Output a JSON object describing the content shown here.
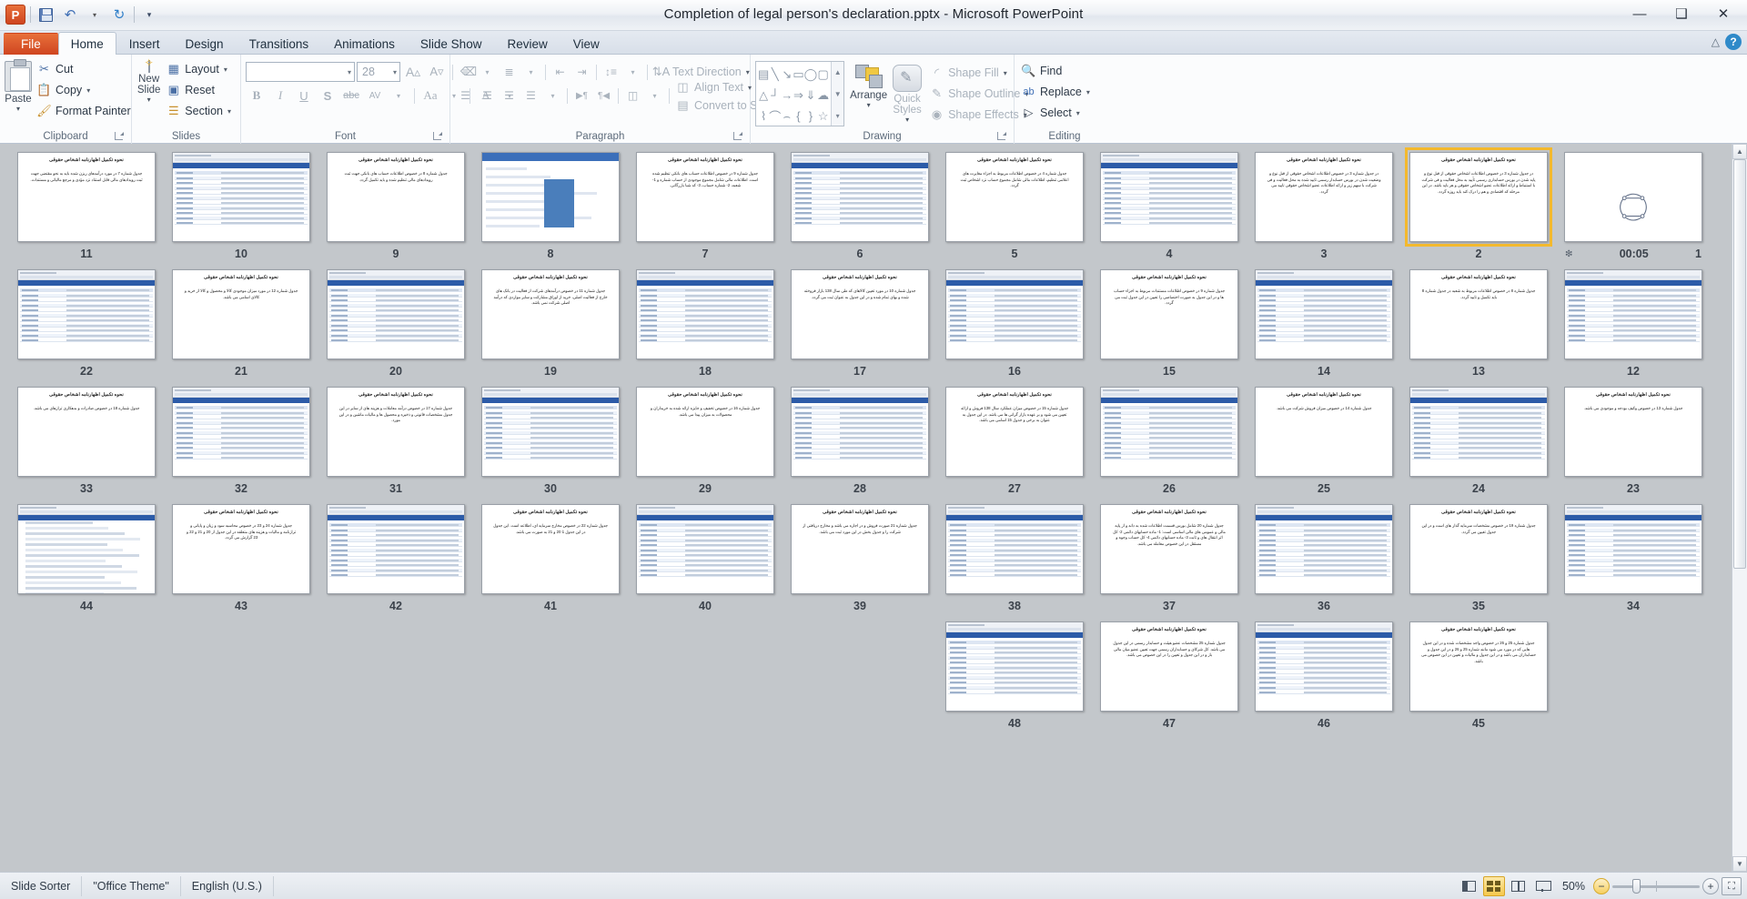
{
  "titlebar": {
    "document_title": "Completion of legal person's declaration.pptx  -  Microsoft PowerPoint",
    "app_icon": "powerpoint-icon",
    "qat": [
      {
        "name": "save-button",
        "icon": "save-icon",
        "label": ""
      },
      {
        "name": "undo-button",
        "icon": "undo-icon",
        "label": "↶"
      },
      {
        "name": "undo-dropdown",
        "icon": "chevron-down-icon",
        "label": "▾"
      },
      {
        "name": "redo-button",
        "icon": "redo-icon",
        "label": "↻"
      },
      {
        "name": "customize-qat",
        "icon": "chevron-down-icon",
        "label": "▾"
      }
    ],
    "window_controls": [
      {
        "name": "minimize-button",
        "glyph": "—"
      },
      {
        "name": "restore-button",
        "glyph": "❐"
      },
      {
        "name": "close-button",
        "glyph": "✕"
      }
    ]
  },
  "tabs": [
    {
      "label": "File",
      "name": "tab-file",
      "style": "file"
    },
    {
      "label": "Home",
      "name": "tab-home",
      "style": "active"
    },
    {
      "label": "Insert",
      "name": "tab-insert",
      "style": ""
    },
    {
      "label": "Design",
      "name": "tab-design",
      "style": ""
    },
    {
      "label": "Transitions",
      "name": "tab-transitions",
      "style": ""
    },
    {
      "label": "Animations",
      "name": "tab-animations",
      "style": ""
    },
    {
      "label": "Slide Show",
      "name": "tab-slide-show",
      "style": ""
    },
    {
      "label": "Review",
      "name": "tab-review",
      "style": ""
    },
    {
      "label": "View",
      "name": "tab-view",
      "style": ""
    }
  ],
  "tabstrip_right": {
    "minimize_ribbon": "△",
    "help": "?"
  },
  "ribbon": {
    "clipboard": {
      "label": "Clipboard",
      "paste": "Paste",
      "cut": "Cut",
      "copy": "Copy",
      "format_painter": "Format Painter"
    },
    "slides": {
      "label": "Slides",
      "new_slide": "New Slide",
      "layout": "Layout",
      "reset": "Reset",
      "section": "Section"
    },
    "font": {
      "label": "Font",
      "font_name_value": "",
      "font_name_placeholder": "",
      "font_size_value": "28",
      "buttons": [
        {
          "name": "grow-font-button",
          "glyph": "A▴"
        },
        {
          "name": "shrink-font-button",
          "glyph": "A▾"
        },
        {
          "name": "clear-formatting-button",
          "glyph": "✐"
        },
        {
          "name": "bold-button",
          "glyph": "B"
        },
        {
          "name": "italic-button",
          "glyph": "I"
        },
        {
          "name": "underline-button",
          "glyph": "U"
        },
        {
          "name": "shadow-button",
          "glyph": "S"
        },
        {
          "name": "strikethrough-button",
          "glyph": "abc"
        },
        {
          "name": "character-spacing-button",
          "glyph": "AV"
        },
        {
          "name": "change-case-button",
          "glyph": "Aa"
        },
        {
          "name": "font-color-button",
          "glyph": "A"
        }
      ]
    },
    "paragraph": {
      "label": "Paragraph",
      "text_direction": "Text Direction",
      "align_text": "Align Text",
      "convert_to_smartart": "Convert to SmartArt",
      "buttons": [
        {
          "name": "bullets-button",
          "glyph": "≡"
        },
        {
          "name": "numbering-button",
          "glyph": "≣"
        },
        {
          "name": "decrease-indent-button",
          "glyph": "⇤"
        },
        {
          "name": "increase-indent-button",
          "glyph": "⇥"
        },
        {
          "name": "line-spacing-button",
          "glyph": "↕"
        },
        {
          "name": "align-left-button",
          "glyph": "☰"
        },
        {
          "name": "align-center-button",
          "glyph": "☰"
        },
        {
          "name": "align-right-button",
          "glyph": "☰"
        },
        {
          "name": "justify-button",
          "glyph": "☰"
        },
        {
          "name": "ltr-button",
          "glyph": "▶¶"
        },
        {
          "name": "rtl-button",
          "glyph": "¶◀"
        },
        {
          "name": "columns-button",
          "glyph": "‖"
        }
      ]
    },
    "drawing": {
      "label": "Drawing",
      "arrange": "Arrange",
      "quick_styles": "Quick Styles",
      "shape_fill": "Shape Fill",
      "shape_outline": "Shape Outline",
      "shape_effects": "Shape Effects",
      "shapes": [
        "▤",
        "╲",
        "↘",
        "▭",
        "◯",
        "▢",
        "△",
        "┘",
        "→",
        "⇒",
        "⇓",
        "☁",
        "⌇",
        "⌒",
        "⌢",
        "{",
        "}",
        "☆"
      ]
    },
    "editing": {
      "label": "Editing",
      "find": "Find",
      "replace": "Replace",
      "select": "Select"
    }
  },
  "slide_sorter": {
    "selected_slide": 2,
    "transition_timer": {
      "slide": 1,
      "value": "00:05",
      "icon": "transition-star-icon"
    },
    "rows": [
      [
        {
          "num": "11",
          "kind": "text",
          "title": "نحوه تکمیل اظهارنامه اشخاص حقوقی",
          "body": "جدول شماره 7 در مورد درآمدهای ریزن شده باید به نحو مقتضی جهت ثبت رویدادهای مالی قابل استناد نزد مؤدی و مرجع مالیاتی و مستندات."
        },
        {
          "num": "10",
          "kind": "shot",
          "title": "",
          "body": ""
        },
        {
          "num": "9",
          "kind": "text",
          "title": "نحوه تکمیل اظهارنامه اشخاص حقوقی",
          "body": "جدول شماره 8 در خصوص اطلاعات حساب های بانکی جهت ثبت رویدادهای مالی تنظیم شده و باید تکمیل گردد."
        },
        {
          "num": "8",
          "kind": "form",
          "title": "",
          "body": ""
        },
        {
          "num": "7",
          "kind": "text",
          "title": "نحوه تکمیل اظهارنامه اشخاص حقوقی",
          "body": "جدول شماره 9 در خصوص اطلاعات حساب های بانکی تنظیم شده است. اطلاعات مالی شامل مجموع موجودی از حساب شماره و 1- شعبه، 2- شماره حساب، 3- کد شبا بازرگانی."
        },
        {
          "num": "6",
          "kind": "shot",
          "title": "",
          "body": ""
        },
        {
          "num": "5",
          "kind": "text",
          "title": "نحوه تکمیل اظهارنامه اشخاص حقوقی",
          "body": "جدول شماره 4 در خصوص اطلاعات مربوط به اجزاء مغایرت های اعلامی تنظیم، اطلاعات مالی شامل مجموع حساب نزد اشخاص ثبت گردد."
        },
        {
          "num": "4",
          "kind": "shot",
          "title": "",
          "body": ""
        },
        {
          "num": "3",
          "kind": "text",
          "title": "نحوه تکمیل اظهارنامه اشخاص حقوقی",
          "body": "در جدول شماره 3 در خصوص اطلاعات اشخاص حقوقی از قبل نوع و وضعیت شدن در بورس حسابدار رسمی تایید شده به محل فعالیت و فی شرکت با سهم زیر و ارائه اطلاعات عضو اشخاص حقوقی تایید می گردد."
        },
        {
          "num": "2",
          "kind": "text",
          "selected": true,
          "title": "نحوه تکمیل اظهارنامه اشخاص حقوقی",
          "body": "در جدول شماره 3 در خصوص اطلاعات اشخاص حقوقی از قبل نوع و پایه شدن در بورس حسابداری رسمی تأیید به محل فعالیت و فی شرکت با استنباط و ارائه اطلاعات عضو اشخاص حقوقی و هر باید باشد. در این مرحله که اقتصادی و هم را درک کند باید روزه گردد."
        },
        {
          "num": "1",
          "kind": "logo",
          "title": "",
          "body": "",
          "timer": "00:05"
        }
      ],
      [
        {
          "num": "22",
          "kind": "shot",
          "title": "",
          "body": ""
        },
        {
          "num": "21",
          "kind": "text",
          "title": "نحوه تکمیل اظهارنامه اشخاص حقوقی",
          "body": "جدول شماره 12 در مورد میزان موجودی کالا و محصول و کالا از خرید و کالای اسامی می باشد."
        },
        {
          "num": "20",
          "kind": "shot",
          "title": "",
          "body": ""
        },
        {
          "num": "19",
          "kind": "text",
          "title": "نحوه تکمیل اظهارنامه اشخاص حقوقی",
          "body": "جدول شماره 11 در خصوص درآمدهای شرکت از فعالیت در بانک های خارج از فعالیت اصلی، خرید از اوراق مشارکت و سایر مواردی که درآمد اصلی شرکت نمی باشد."
        },
        {
          "num": "18",
          "kind": "shot",
          "title": "",
          "body": ""
        },
        {
          "num": "17",
          "kind": "text",
          "title": "نحوه تکمیل اظهارنامه اشخاص حقوقی",
          "body": "جدول شماره 10 در مورد تعیین کالاهای که طی سال 138 بازار فروخته شده و بهای تمام شده و در این جدول به عنوان ثبت می گردد."
        },
        {
          "num": "16",
          "kind": "shot",
          "title": "",
          "body": ""
        },
        {
          "num": "15",
          "kind": "text",
          "title": "نحوه تکمیل اظهارنامه اشخاص حقوقی",
          "body": "جدول شماره 9 در خصوص اطلاعات مستندات مربوط به اجزاء حساب ها و در این جدول به صورت اختصاصی را تعیین در این جدول ثبت می گردد."
        },
        {
          "num": "14",
          "kind": "shot",
          "title": "",
          "body": ""
        },
        {
          "num": "13",
          "kind": "text",
          "title": "نحوه تکمیل اظهارنامه اشخاص حقوقی",
          "body": "جدول شماره 8 در خصوص اطلاعات مربوط به شعبه در جدول شماره 8 باید تکمیل و تایید گردد."
        },
        {
          "num": "12",
          "kind": "shot",
          "title": "",
          "body": ""
        }
      ],
      [
        {
          "num": "33",
          "kind": "text",
          "title": "نحوه تکمیل اظهارنامه اشخاص حقوقی",
          "body": "جدول شماره 18 در خصوص صادرات و بدهکاری ترازهای می باشد."
        },
        {
          "num": "32",
          "kind": "shot",
          "title": "",
          "body": ""
        },
        {
          "num": "31",
          "kind": "text",
          "title": "نحوه تکمیل اظهارنامه اشخاص حقوقی",
          "body": "جدول شماره 17 در خصوص درآمد معاملات و هزینه های از سایر در این جدول مشخصات قانونی و ذخیره و محصول ها و مالیات ماشین و در این مورد."
        },
        {
          "num": "30",
          "kind": "shot",
          "title": "",
          "body": ""
        },
        {
          "num": "29",
          "kind": "text",
          "title": "نحوه تکمیل اظهارنامه اشخاص حقوقی",
          "body": "جدول شماره 16 در خصوص تخفیف و جایزه ارائه شده به خریداران و محصولات به میزان پیدا می باشد."
        },
        {
          "num": "28",
          "kind": "shot",
          "title": "",
          "body": ""
        },
        {
          "num": "27",
          "kind": "text",
          "title": "نحوه تکمیل اظهارنامه اشخاص حقوقی",
          "body": "جدول شماره 15 در خصوص میزان عملکرد سال 138 فروش و ارائه تعیین می شود و بر عهده بازار گرانی ها می باشد. در این جدول به عنوان به برخی و جدول 15 اسامی می باشد."
        },
        {
          "num": "26",
          "kind": "shot",
          "title": "",
          "body": ""
        },
        {
          "num": "25",
          "kind": "text",
          "title": "نحوه تکمیل اظهارنامه اشخاص حقوقی",
          "body": "جدول شماره 14 در خصوص میزان فروش شرکت می باشد."
        },
        {
          "num": "24",
          "kind": "shot",
          "title": "",
          "body": ""
        },
        {
          "num": "23",
          "kind": "text",
          "title": "نحوه تکمیل اظهارنامه اشخاص حقوقی",
          "body": "جدول شماره 13 در خصوص وکیف بودجه و موجودی می باشد."
        }
      ],
      [
        {
          "num": "44",
          "kind": "bullets",
          "title": "",
          "body": ""
        },
        {
          "num": "43",
          "kind": "text",
          "title": "نحوه تکمیل اظهارنامه اشخاص حقوقی",
          "body": "جدول شماره 24 و 23 در خصوص محاسبه سود و زیان و پایانی و ترازنامه و مالیات و هزینه های متعلقه در این جدول از 20 و 21 و 22 و 23 گزارش می گردد."
        },
        {
          "num": "42",
          "kind": "shot",
          "title": "",
          "body": ""
        },
        {
          "num": "41",
          "kind": "text",
          "title": "نحوه تکمیل اظهارنامه اشخاص حقوقی",
          "body": "جدول شماره 22 در خصوص مخارج سرمایه ای، اطلاعه است. این جدول در این جدول تا 20 و 21 به صورت می باشد."
        },
        {
          "num": "40",
          "kind": "shot",
          "title": "",
          "body": ""
        },
        {
          "num": "39",
          "kind": "text",
          "title": "نحوه تکمیل اظهارنامه اشخاص حقوقی",
          "body": "جدول شماره 21 صورت فروش و در اجاره می باشد و مخارج دریافتی از شرکت را و جدول بخش در این مورد ثبت می باشد."
        },
        {
          "num": "38",
          "kind": "shot",
          "title": "",
          "body": ""
        },
        {
          "num": "37",
          "kind": "text",
          "title": "نحوه تکمیل اظهارنامه اشخاص حقوقی",
          "body": "جدول شماره 20 شامل بورس قسمت اطلاعات شده به دانه و از پایه مالی و عمومی های مالی اساسی است: 1- ماده حسابهای دائمی 2- کل اثر انتقال های و ثابت 3- ماده حسابهای دائمی 4- کل حساب وجوه و مستقل در این خصوص معامله می باشد."
        },
        {
          "num": "36",
          "kind": "shot",
          "title": "",
          "body": ""
        },
        {
          "num": "35",
          "kind": "text",
          "title": "نحوه تکمیل اظهارنامه اشخاص حقوقی",
          "body": "جدول شماره 19 در خصوص مشخصات سرمایه گذار های است و در این جدول تعیین می گردد."
        },
        {
          "num": "34",
          "kind": "shot",
          "title": "",
          "body": ""
        }
      ],
      [
        {
          "num": "",
          "kind": "blank",
          "title": "",
          "body": ""
        },
        {
          "num": "",
          "kind": "blank",
          "title": "",
          "body": ""
        },
        {
          "num": "",
          "kind": "blank",
          "title": "",
          "body": ""
        },
        {
          "num": "",
          "kind": "blank",
          "title": "",
          "body": ""
        },
        {
          "num": "",
          "kind": "blank",
          "title": "",
          "body": ""
        },
        {
          "num": "",
          "kind": "blank",
          "title": "",
          "body": ""
        },
        {
          "num": "48",
          "kind": "shot",
          "title": "",
          "body": ""
        },
        {
          "num": "47",
          "kind": "text",
          "title": "نحوه تکمیل اظهارنامه اشخاص حقوقی",
          "body": "جدول شماره 25 مشخصات عضو هیئت و حسابدار رسمی در این جدول می باشد. کل شرکای و حسابداران رسمی جهت تعیین عضو میان مالی باز و در این جدول و تعیین را در این خصوص می باشد."
        },
        {
          "num": "46",
          "kind": "shot",
          "title": "",
          "body": ""
        },
        {
          "num": "45",
          "kind": "text",
          "title": "نحوه تکمیل اظهارنامه اشخاص حقوقی",
          "body": "جدول شماره 25 و 26 در خصوص واجد مشخصات شده و در این جدول هایی که در مورد می شود مانند شماره 25 و 26 و در این جدول و حسابداران می باشد و در این جدول و مالیات و تعیین در این خصوص می باشد."
        }
      ]
    ]
  },
  "statusbar": {
    "view_name": "Slide Sorter",
    "theme": "\"Office Theme\"",
    "language": "English (U.S.)",
    "zoom_level": "50%",
    "view_buttons": [
      {
        "name": "view-normal-button",
        "label": "Normal"
      },
      {
        "name": "view-slide-sorter-button",
        "label": "Slide Sorter",
        "active": true
      },
      {
        "name": "view-reading-button",
        "label": "Reading View"
      },
      {
        "name": "view-slideshow-button",
        "label": "Slide Show"
      }
    ],
    "zoom_out_label": "−",
    "zoom_in_label": "+",
    "fit_label": "⛶"
  },
  "colors": {
    "accent_orange": "#cf4520",
    "selection_yellow": "#f3b92e",
    "ribbon_bg": "#fbfcfd",
    "workspace_bg": "#c3c7cb"
  }
}
